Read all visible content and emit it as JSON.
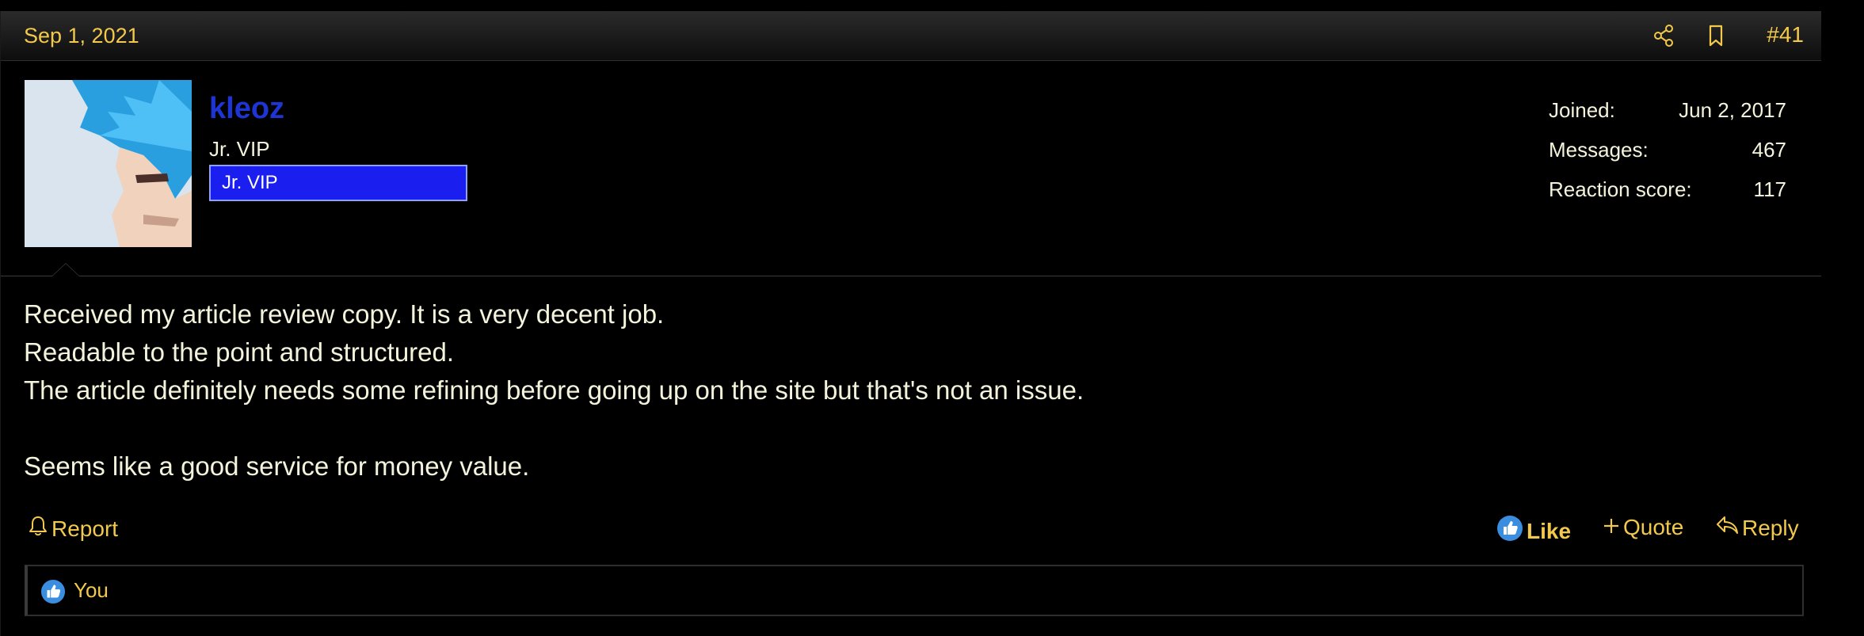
{
  "post": {
    "date": "Sep 1, 2021",
    "number": "#41",
    "header_icons": [
      "share-icon",
      "bookmark-icon"
    ]
  },
  "user": {
    "name": "kleoz",
    "title": "Jr. VIP",
    "banner": "Jr. VIP",
    "stats": [
      {
        "label": "Joined:",
        "value": "Jun 2, 2017"
      },
      {
        "label": "Messages:",
        "value": "467"
      },
      {
        "label": "Reaction score:",
        "value": "117"
      }
    ]
  },
  "message": {
    "lines": [
      "Received my article review copy. It is a very decent job.",
      "Readable to the point and structured.",
      "The article definitely needs some refining before going up on the site but that's not an issue.",
      "",
      "Seems like a good service for money value."
    ]
  },
  "actions": {
    "report": "Report",
    "like": "Like",
    "quote": "Quote",
    "reply": "Reply"
  },
  "reactions": {
    "text": "You"
  },
  "colors": {
    "accent": "#f2c94c",
    "username": "#1e35d6",
    "banner_bg": "#1a1ff0",
    "like_blue": "#3b8de0",
    "text": "#f4f4dc"
  }
}
